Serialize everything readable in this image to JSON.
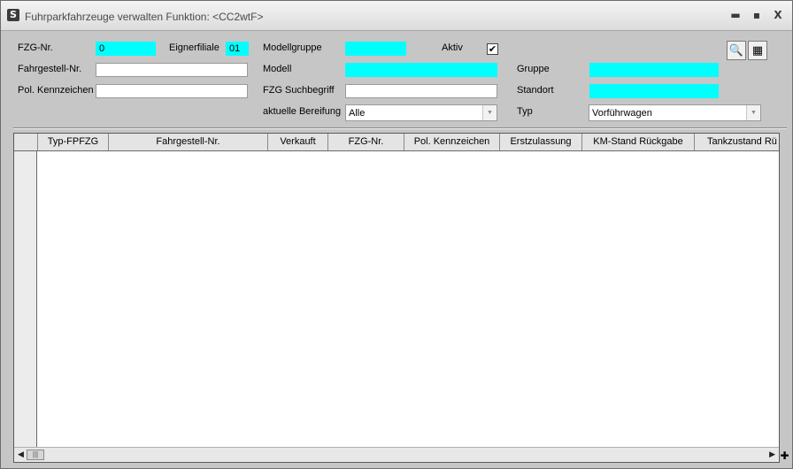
{
  "window": {
    "title": "Fuhrparkfahrzeuge verwalten   Funktion: <CC2wtF>",
    "icon": "S",
    "minimize": "▬",
    "maximize": "▪",
    "close": "X"
  },
  "form": {
    "fzg_nr": {
      "label": "FZG-Nr.",
      "value": "0"
    },
    "eignerfiliale": {
      "label": "Eignerfiliale",
      "value": "01"
    },
    "modellgruppe": {
      "label": "Modellgruppe",
      "value": ""
    },
    "aktiv": {
      "label": "Aktiv",
      "checked": true,
      "glyph": "✔"
    },
    "fahrgestell_nr": {
      "label": "Fahrgestell-Nr.",
      "value": ""
    },
    "modell": {
      "label": "Modell",
      "value": ""
    },
    "gruppe": {
      "label": "Gruppe",
      "value": ""
    },
    "pol_kennzeichen": {
      "label": "Pol. Kennzeichen",
      "value": ""
    },
    "fzg_suchbegriff": {
      "label": "FZG Suchbegriff",
      "value": ""
    },
    "standort": {
      "label": "Standort",
      "value": ""
    },
    "aktuelle_bereifung": {
      "label": "aktuelle Bereifung",
      "value": "Alle"
    },
    "typ": {
      "label": "Typ",
      "value": "Vorführwagen"
    },
    "search_icon": "🔍",
    "calendar_icon": "▦",
    "highlight_color": "#00ffff"
  },
  "grid": {
    "columns": [
      "Typ-FPFZG",
      "Fahrgestell-Nr.",
      "Verkauft",
      "FZG-Nr.",
      "Pol. Kennzeichen",
      "Erstzulassung",
      "KM-Stand Rückgabe",
      "Tankzustand Rü"
    ],
    "rows": [],
    "scroll_left": "◀",
    "scroll_thumb": "|||",
    "scroll_right": "▶",
    "add_button": "✚"
  }
}
